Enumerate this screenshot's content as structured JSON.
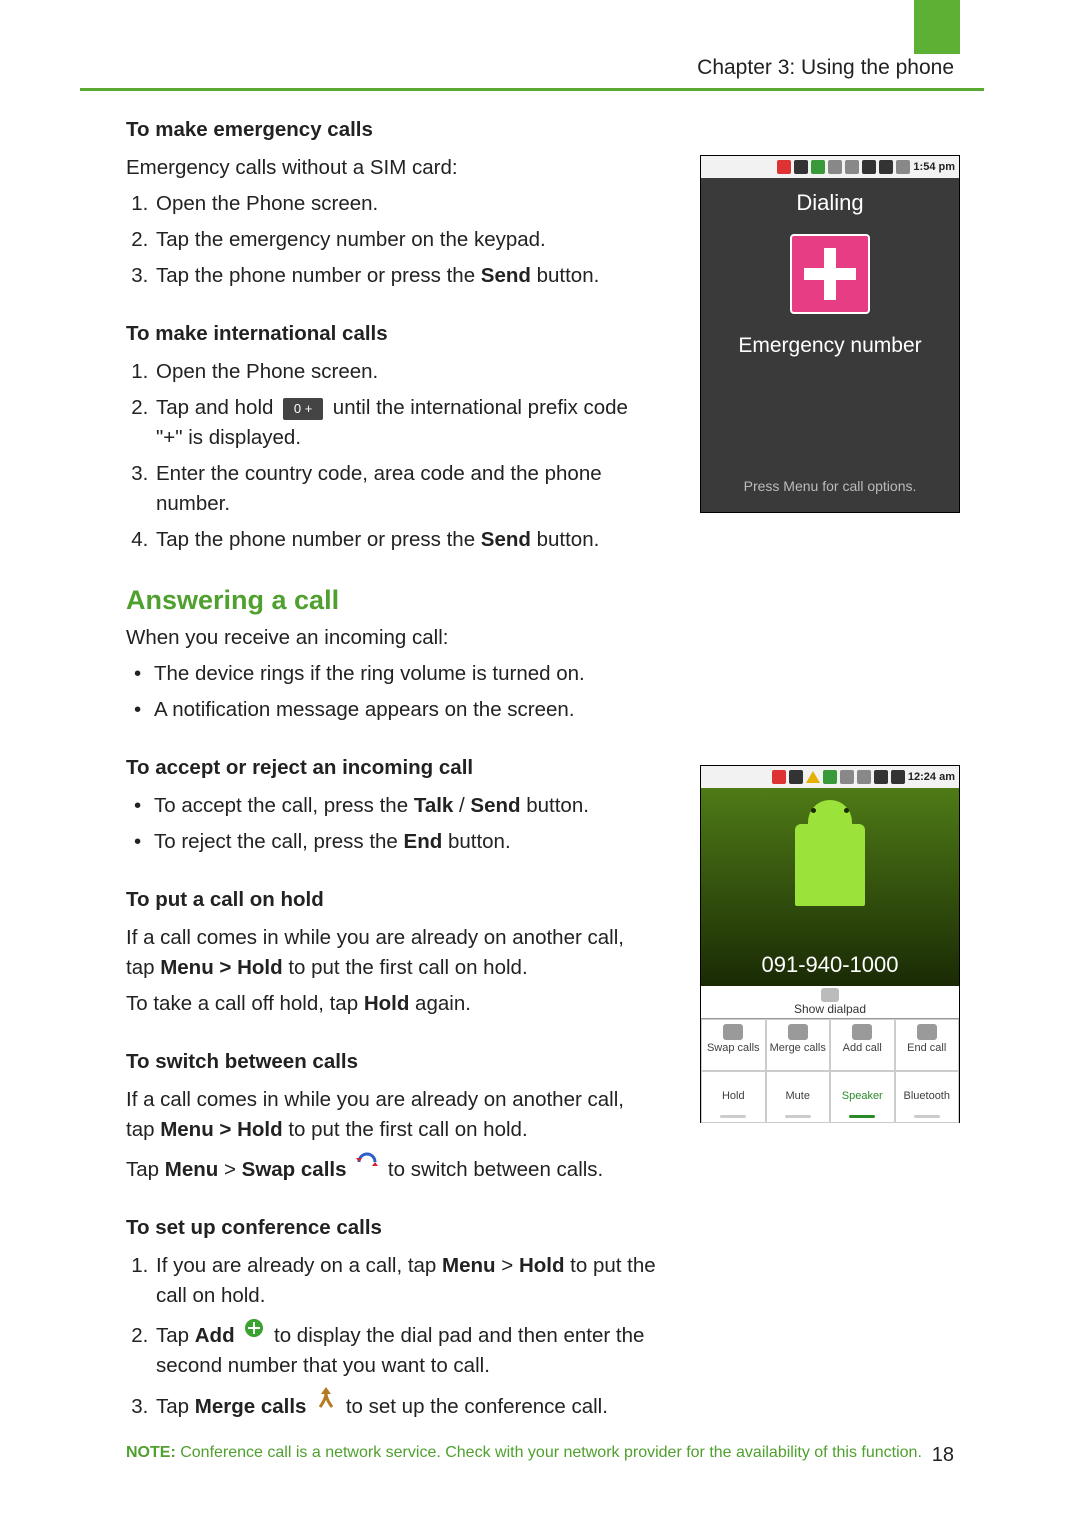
{
  "header": {
    "chapter": "Chapter 3: Using the phone"
  },
  "s1": {
    "h": "To make emergency calls",
    "intro": "Emergency calls without a SIM card:",
    "steps": {
      "a": "Open the Phone screen.",
      "b": "Tap the emergency number on the keypad.",
      "c_pre": "Tap the phone number or press the ",
      "c_b": "Send",
      "c_post": " button."
    }
  },
  "s2": {
    "h": "To make international calls",
    "steps": {
      "a": "Open the Phone screen.",
      "b_pre": "Tap and hold ",
      "b_key": "0 +",
      "b_post": " until the international prefix code \"+\" is displayed.",
      "c": "Enter the country code, area code and the phone number.",
      "d_pre": "Tap the phone number or press the ",
      "d_b": "Send",
      "d_post": " button."
    }
  },
  "answer": {
    "h": "Answering a call",
    "intro": "When you receive an incoming call:",
    "bul": {
      "a": "The device rings if the ring volume is turned on.",
      "b": "A notification message appears on the screen."
    }
  },
  "s3": {
    "h": "To accept or reject an incoming call",
    "bul": {
      "a_pre": "To accept the call, press the ",
      "a_b1": "Talk",
      "a_mid": " / ",
      "a_b2": "Send",
      "a_post": " button.",
      "b_pre": "To reject the call, press the ",
      "b_b": "End",
      "b_post": " button."
    }
  },
  "s4": {
    "h": "To put a call on hold",
    "p1_pre": "If a call comes in while you are already on another call, tap ",
    "p1_b": "Menu > Hold",
    "p1_post": " to put the first call on hold.",
    "p2_pre": "To take a call off hold, tap ",
    "p2_b": "Hold",
    "p2_post": " again."
  },
  "s5": {
    "h": "To switch between calls",
    "p1_pre": "If a call comes in while you are already on another call, tap ",
    "p1_b": "Menu > Hold",
    "p1_post": " to put the first call on hold.",
    "p2_pre": "Tap ",
    "p2_b1": "Menu",
    "p2_mid": " > ",
    "p2_b2": "Swap calls",
    "p2_post": " to switch between calls."
  },
  "s6": {
    "h": "To set up conference calls",
    "steps": {
      "a_pre": "If you are already on a call, tap ",
      "a_b1": "Menu",
      "a_mid": " > ",
      "a_b2": "Hold",
      "a_post": " to put the call on hold.",
      "b_pre": "Tap ",
      "b_b": "Add",
      "b_post": " to display the dial pad and then enter the second number that you want to call.",
      "c_pre": "Tap ",
      "c_b": "Merge calls",
      "c_post": " to set up the conference call."
    }
  },
  "note": {
    "label": "NOTE:",
    "text": " Conference call is a network service. Check with your network provider for the availability of this function."
  },
  "shot1": {
    "time": "1:54 pm",
    "title": "Dialing",
    "label": "Emergency number",
    "menu": "Press Menu for call options."
  },
  "shot2": {
    "time": "12:24 am",
    "number": "091-940-1000",
    "showdial": "Show dialpad",
    "btns": {
      "swap": "Swap calls",
      "merge": "Merge calls",
      "add": "Add call",
      "end": "End call",
      "hold": "Hold",
      "mute": "Mute",
      "speaker": "Speaker",
      "bt": "Bluetooth"
    }
  },
  "pageno": "18"
}
